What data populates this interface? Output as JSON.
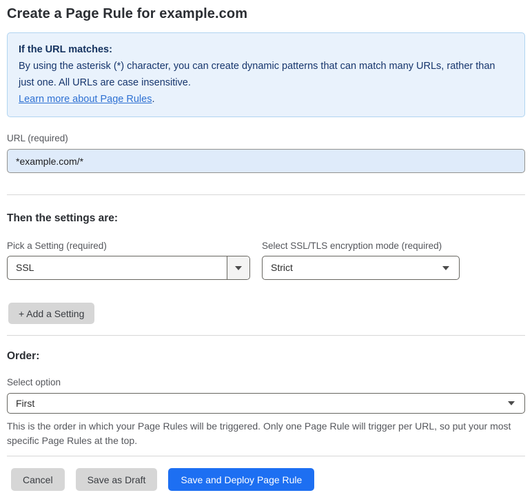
{
  "page": {
    "title": "Create a Page Rule for example.com"
  },
  "info_box": {
    "heading": "If the URL matches:",
    "body": "By using the asterisk (*) character, you can create dynamic patterns that can match many URLs, rather than just one. All URLs are case insensitive.",
    "link_label": "Learn more about Page Rules",
    "link_suffix": "."
  },
  "url_field": {
    "label": "URL (required)",
    "value": "*example.com/*"
  },
  "settings_section": {
    "heading": "Then the settings are:",
    "setting_select": {
      "label": "Pick a Setting (required)",
      "value": "SSL"
    },
    "mode_select": {
      "label": "Select SSL/TLS encryption mode (required)",
      "value": "Strict"
    },
    "add_setting_label": "+ Add a Setting"
  },
  "order_section": {
    "heading": "Order:",
    "select_label": "Select option",
    "select_value": "First",
    "help_text": "This is the order in which your Page Rules will be triggered. Only one Page Rule will trigger per URL, so put your most specific Page Rules at the top."
  },
  "footer": {
    "cancel_label": "Cancel",
    "save_draft_label": "Save as Draft",
    "save_deploy_label": "Save and Deploy Page Rule"
  },
  "colors": {
    "info_background": "#e9f2fc",
    "info_border": "#b0d4f1",
    "info_text": "#16356c",
    "link_blue": "#2e71d3",
    "url_input_background": "#dfebfa",
    "gray_button": "#d6d6d6",
    "primary_button_blue": "#1d6ff2"
  }
}
